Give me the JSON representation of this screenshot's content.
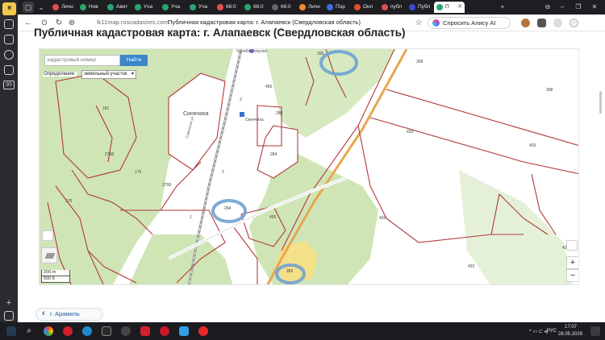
{
  "browser": {
    "tabs": [
      {
        "label": "Личн",
        "color": "#e04f4f"
      },
      {
        "label": "Нов",
        "color": "#2aa56e"
      },
      {
        "label": "Авит",
        "color": "#2aa56e"
      },
      {
        "label": "Уча",
        "color": "#2aa56e"
      },
      {
        "label": "Уча",
        "color": "#2aa56e"
      },
      {
        "label": "Уча",
        "color": "#2aa56e"
      },
      {
        "label": "66:0",
        "color": "#e04f4f"
      },
      {
        "label": "66:0",
        "color": "#2aa56e"
      },
      {
        "label": "66:0",
        "color": "#666"
      },
      {
        "label": "Личн",
        "color": "#f28b2c"
      },
      {
        "label": "Пор",
        "color": "#3a6fe0"
      },
      {
        "label": "Онл",
        "color": "#e0502c"
      },
      {
        "label": "публ",
        "color": "#e04f4f"
      },
      {
        "label": "Публ",
        "color": "#3a4ad0"
      },
      {
        "label": "П",
        "color": "#2aa56e",
        "active": true
      }
    ],
    "url_host": "lk11map.roscadastres.com",
    "url_title": "Публичная кадастровая карта: г. Алапаевск (Свердловская область)",
    "alice_label": "Спросить Алису AI"
  },
  "page": {
    "heading": "Публичная кадастровая карта: г. Алапаевск (Свердловская область)",
    "back_link": "г. Арамиль"
  },
  "map": {
    "search_placeholder": "кадастровый номер",
    "search_button": "Найти",
    "definition_label": "Определение:",
    "definition_value": "земельный участок",
    "scale_m": "200 m",
    "scale_ft": "500 ft",
    "zoom_in": "+",
    "zoom_out": "−",
    "labels": {
      "sinyachikha": "Синячиха",
      "sinyachikha_station": "Синячиха",
      "chelyabtorg": "Челябагропромт",
      "p265": "265",
      "p398a": "398",
      "p398b": "398",
      "p465": "465",
      "p181": "181",
      "p288": "288",
      "p2a": "2",
      "p2b": "2",
      "p433a": "433",
      "p433b": "433",
      "p433c": "433",
      "p433d": "433",
      "p403": "403",
      "p2798a": "2798",
      "p2798b": "2798",
      "p179": "179",
      "p176": "176",
      "p264": "264",
      "p455": "455",
      "p262": "262",
      "p1": "1",
      "p284": "284",
      "street": "Советская ул."
    }
  },
  "taskbar": {
    "lang": "РУС",
    "time": "17:07",
    "date": "28.05.2026"
  }
}
